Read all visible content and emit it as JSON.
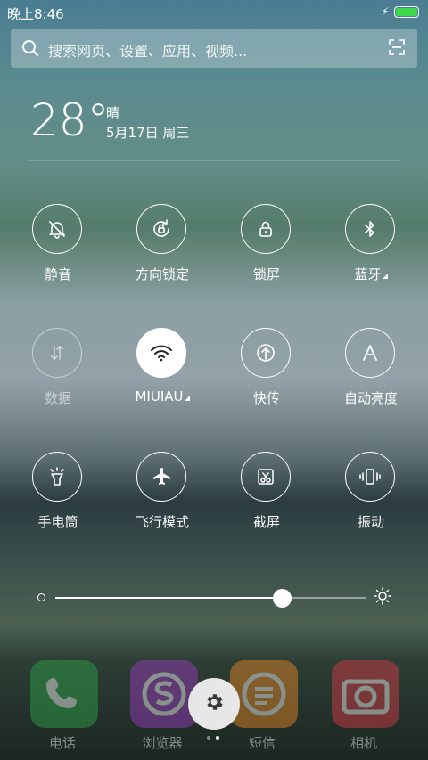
{
  "status_bar": {
    "time": "晚上8:46",
    "battery_percent": 100,
    "charging_icon": "lightning-icon",
    "battery_color": "#3ad84a"
  },
  "search": {
    "placeholder": "搜索网页、设置、应用、视频...",
    "icon": "search-icon",
    "scan_icon": "scan-icon"
  },
  "weather": {
    "temperature": "28°",
    "condition": "晴",
    "date": "5月17日 周三"
  },
  "toggles": [
    {
      "label": "静音",
      "icon": "bell-off-icon",
      "state": "off"
    },
    {
      "label": "方向锁定",
      "icon": "rotation-lock-icon",
      "state": "off"
    },
    {
      "label": "锁屏",
      "icon": "lock-icon",
      "state": "off"
    },
    {
      "label": "蓝牙",
      "icon": "bluetooth-icon",
      "state": "off",
      "expandable": true
    },
    {
      "label": "数据",
      "icon": "data-arrows-icon",
      "state": "disabled"
    },
    {
      "label": "MIUIAU",
      "icon": "wifi-icon",
      "state": "on",
      "expandable": true
    },
    {
      "label": "快传",
      "icon": "upload-icon",
      "state": "off"
    },
    {
      "label": "自动亮度",
      "icon": "auto-brightness-icon",
      "state": "off"
    },
    {
      "label": "手电筒",
      "icon": "flashlight-icon",
      "state": "off"
    },
    {
      "label": "飞行模式",
      "icon": "airplane-icon",
      "state": "off"
    },
    {
      "label": "截屏",
      "icon": "screenshot-icon",
      "state": "off"
    },
    {
      "label": "振动",
      "icon": "vibrate-icon",
      "state": "off"
    }
  ],
  "brightness": {
    "value_percent": 73
  },
  "dock": {
    "apps": [
      {
        "label": "电话",
        "icon": "phone-icon",
        "color": "#2fa84a"
      },
      {
        "label": "浏览器",
        "icon": "browser-icon",
        "color": "#a03cc8"
      },
      {
        "label": "短信",
        "icon": "message-icon",
        "color": "#f08a24"
      },
      {
        "label": "相机",
        "icon": "camera-icon",
        "color": "#e03a4a"
      }
    ],
    "settings_button_icon": "gear-icon",
    "page_count": 2,
    "current_page": 2
  }
}
